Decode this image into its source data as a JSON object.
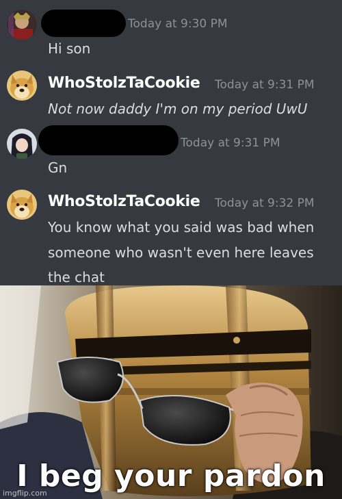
{
  "messages": [
    {
      "username": "",
      "timestamp": "Today at 9:30 PM",
      "text": "Hi son"
    },
    {
      "username": "WhoStolzTaCookie",
      "timestamp": "Today at 9:31 PM",
      "text": "Not now daddy I'm on my period UwU"
    },
    {
      "username": "",
      "timestamp": "Today at 9:31 PM",
      "text": "Gn"
    },
    {
      "username": "WhoStolzTaCookie",
      "timestamp": "Today at 9:32 PM",
      "lines": [
        "You know what you said was bad when",
        "someone who wasn't even here leaves",
        "the chat"
      ]
    }
  ],
  "meme": {
    "caption": "I beg your pardon",
    "watermark": "imgflip.com"
  },
  "colors": {
    "background": "#36393f",
    "username": "#ffffff",
    "timestamp": "#8e9297",
    "message_text": "#dcddde"
  },
  "icons": [
    "avatar-crowned-user",
    "doge-avatar",
    "anime-avatar",
    "knight-helmet-photo"
  ]
}
